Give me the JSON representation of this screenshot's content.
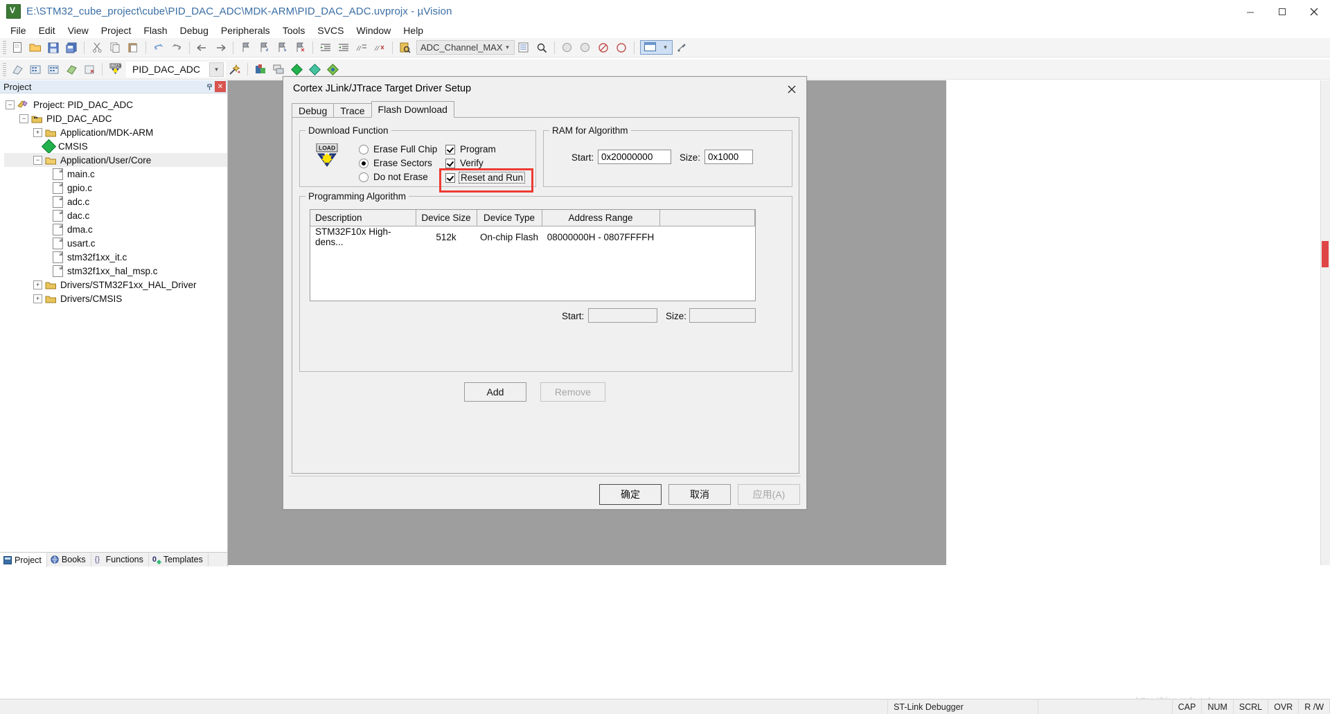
{
  "window": {
    "title": "E:\\STM32_cube_project\\cube\\PID_DAC_ADC\\MDK-ARM\\PID_DAC_ADC.uvprojx - µVision",
    "app_icon": "uvision-icon",
    "minimize": "minimize-icon",
    "maximize": "maximize-icon",
    "close": "close-icon"
  },
  "menu": {
    "items": [
      "File",
      "Edit",
      "View",
      "Project",
      "Flash",
      "Debug",
      "Peripherals",
      "Tools",
      "SVCS",
      "Window",
      "Help"
    ]
  },
  "toolbar1": {
    "target_combo_value": "ADC_Channel_MAX",
    "icons": [
      "new-file-icon",
      "open-file-icon",
      "save-icon",
      "save-all-icon",
      "cut-icon",
      "copy-icon",
      "paste-icon",
      "undo-icon",
      "redo-icon",
      "navigate-back-icon",
      "navigate-forward-icon",
      "bookmark-toggle-icon",
      "bookmark-prev-icon",
      "bookmark-next-icon",
      "bookmark-clear-icon",
      "indent-icon",
      "outdent-icon",
      "comment-icon",
      "uncomment-icon",
      "find-in-files-icon",
      "find-icon",
      "bookmark-list-icon",
      "zoom-icon",
      "debug-start-icon",
      "reset-icon",
      "stop-icon",
      "window-layout-icon",
      "configure-icon"
    ]
  },
  "toolbar2": {
    "project_combo_value": "PID_DAC_ADC",
    "icons": [
      "translate-icon",
      "build-icon",
      "rebuild-icon",
      "batch-build-icon",
      "stop-build-icon",
      "download-icon",
      "magic-wand-icon",
      "target-options-icon",
      "manage-layers-icon",
      "packs-green-icon",
      "packs-teal-icon",
      "packs-multi-icon"
    ]
  },
  "project_panel": {
    "header": "Project",
    "pin": "pin-icon",
    "close": "close-icon",
    "tree": [
      {
        "label": "Project: PID_DAC_ADC",
        "indent": 0,
        "toggle": "minus",
        "icon": "project-root-icon",
        "selected": false
      },
      {
        "label": "PID_DAC_ADC",
        "indent": 1,
        "toggle": "minus",
        "icon": "target-folder-icon",
        "selected": false
      },
      {
        "label": "Application/MDK-ARM",
        "indent": 2,
        "toggle": "plus",
        "icon": "folder-icon",
        "selected": false
      },
      {
        "label": "CMSIS",
        "indent": 2,
        "toggle": "none",
        "icon": "cmsis-diamond-icon",
        "selected": false
      },
      {
        "label": "Application/User/Core",
        "indent": 2,
        "toggle": "minus",
        "icon": "folder-open-icon",
        "selected": true
      },
      {
        "label": "main.c",
        "indent": 3,
        "toggle": "none",
        "icon": "c-file-icon",
        "selected": false
      },
      {
        "label": "gpio.c",
        "indent": 3,
        "toggle": "none",
        "icon": "c-file-icon",
        "selected": false
      },
      {
        "label": "adc.c",
        "indent": 3,
        "toggle": "none",
        "icon": "c-file-icon",
        "selected": false
      },
      {
        "label": "dac.c",
        "indent": 3,
        "toggle": "none",
        "icon": "c-file-icon",
        "selected": false
      },
      {
        "label": "dma.c",
        "indent": 3,
        "toggle": "none",
        "icon": "c-file-icon",
        "selected": false
      },
      {
        "label": "usart.c",
        "indent": 3,
        "toggle": "none",
        "icon": "c-file-icon",
        "selected": false
      },
      {
        "label": "stm32f1xx_it.c",
        "indent": 3,
        "toggle": "none",
        "icon": "c-file-icon",
        "selected": false
      },
      {
        "label": "stm32f1xx_hal_msp.c",
        "indent": 3,
        "toggle": "none",
        "icon": "c-file-icon",
        "selected": false
      },
      {
        "label": "Drivers/STM32F1xx_HAL_Driver",
        "indent": 2,
        "toggle": "plus",
        "icon": "folder-icon",
        "selected": false
      },
      {
        "label": "Drivers/CMSIS",
        "indent": 2,
        "toggle": "plus",
        "icon": "folder-icon",
        "selected": false
      }
    ]
  },
  "bottom_tabs": [
    {
      "label": "Project",
      "icon": "project-tab-icon",
      "active": true
    },
    {
      "label": "Books",
      "icon": "books-tab-icon",
      "active": false
    },
    {
      "label": "Functions",
      "icon": "functions-tab-icon",
      "active": false
    },
    {
      "label": "Templates",
      "icon": "templates-tab-icon",
      "active": false
    }
  ],
  "dialog": {
    "title": "Cortex JLink/JTrace Target Driver Setup",
    "close": "close-icon",
    "tabs": [
      {
        "label": "Debug",
        "active": false
      },
      {
        "label": "Trace",
        "active": false
      },
      {
        "label": "Flash Download",
        "active": true
      }
    ],
    "download_function": {
      "legend": "Download Function",
      "icon": "load-download-icon",
      "radios": [
        {
          "label": "Erase Full Chip",
          "checked": false
        },
        {
          "label": "Erase Sectors",
          "checked": true
        },
        {
          "label": "Do not Erase",
          "checked": false
        }
      ],
      "checkboxes": [
        {
          "label": "Program",
          "checked": true,
          "focused": false,
          "highlighted": false
        },
        {
          "label": "Verify",
          "checked": true,
          "focused": false,
          "highlighted": false
        },
        {
          "label": "Reset and Run",
          "checked": true,
          "focused": true,
          "highlighted": true
        }
      ],
      "highlight_color": "#ee3b33"
    },
    "ram_for_algorithm": {
      "legend": "RAM for Algorithm",
      "start_label": "Start:",
      "start_value": "0x20000000",
      "size_label": "Size:",
      "size_value": "0x1000"
    },
    "programming_algorithm": {
      "legend": "Programming Algorithm",
      "columns": [
        "Description",
        "Device Size",
        "Device Type",
        "Address Range",
        ""
      ],
      "rows": [
        [
          "STM32F10x High-dens...",
          "512k",
          "On-chip Flash",
          "08000000H - 0807FFFFH",
          ""
        ]
      ],
      "start_label": "Start:",
      "start_value": "",
      "size_label": "Size:",
      "size_value": "",
      "add_button": "Add",
      "remove_button": "Remove",
      "remove_disabled": true
    },
    "footer": {
      "ok": "确定",
      "cancel": "取消",
      "apply": "应用(A)",
      "apply_disabled": true
    }
  },
  "statusbar": {
    "debugger": "ST-Link Debugger",
    "indicators": [
      "CAP",
      "NUM",
      "SCRL",
      "OVR",
      "R /W"
    ]
  },
  "watermark": "https://blog.csdn.net"
}
